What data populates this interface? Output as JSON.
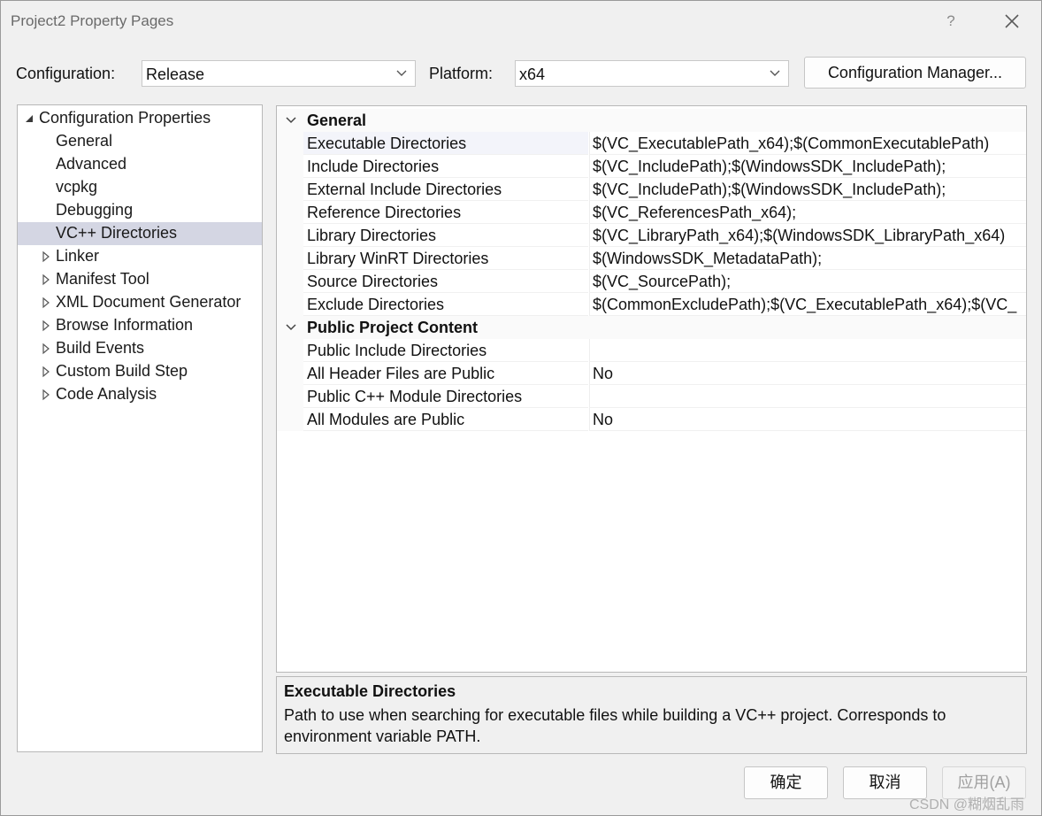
{
  "window": {
    "title": "Project2 Property Pages",
    "help_glyph": "?"
  },
  "config": {
    "configuration_label": "Configuration:",
    "configuration_value": "Release",
    "platform_label": "Platform:",
    "platform_value": "x64",
    "manager_button": "Configuration Manager..."
  },
  "tree": {
    "root": "Configuration Properties",
    "items": [
      {
        "label": "General",
        "expandable": false,
        "selected": false
      },
      {
        "label": "Advanced",
        "expandable": false,
        "selected": false
      },
      {
        "label": "vcpkg",
        "expandable": false,
        "selected": false
      },
      {
        "label": "Debugging",
        "expandable": false,
        "selected": false
      },
      {
        "label": "VC++ Directories",
        "expandable": false,
        "selected": true
      },
      {
        "label": "Linker",
        "expandable": true,
        "selected": false
      },
      {
        "label": "Manifest Tool",
        "expandable": true,
        "selected": false
      },
      {
        "label": "XML Document Generator",
        "expandable": true,
        "selected": false
      },
      {
        "label": "Browse Information",
        "expandable": true,
        "selected": false
      },
      {
        "label": "Build Events",
        "expandable": true,
        "selected": false
      },
      {
        "label": "Custom Build Step",
        "expandable": true,
        "selected": false
      },
      {
        "label": "Code Analysis",
        "expandable": true,
        "selected": false
      }
    ]
  },
  "grid": {
    "categories": [
      {
        "label": "General",
        "rows": [
          {
            "name": "Executable Directories",
            "value": "$(VC_ExecutablePath_x64);$(CommonExecutablePath)"
          },
          {
            "name": "Include Directories",
            "value": "$(VC_IncludePath);$(WindowsSDK_IncludePath);"
          },
          {
            "name": "External Include Directories",
            "value": "$(VC_IncludePath);$(WindowsSDK_IncludePath);"
          },
          {
            "name": "Reference Directories",
            "value": "$(VC_ReferencesPath_x64);"
          },
          {
            "name": "Library Directories",
            "value": "$(VC_LibraryPath_x64);$(WindowsSDK_LibraryPath_x64)"
          },
          {
            "name": "Library WinRT Directories",
            "value": "$(WindowsSDK_MetadataPath);"
          },
          {
            "name": "Source Directories",
            "value": "$(VC_SourcePath);"
          },
          {
            "name": "Exclude Directories",
            "value": "$(CommonExcludePath);$(VC_ExecutablePath_x64);$(VC_"
          }
        ]
      },
      {
        "label": "Public Project Content",
        "rows": [
          {
            "name": "Public Include Directories",
            "value": ""
          },
          {
            "name": "All Header Files are Public",
            "value": "No"
          },
          {
            "name": "Public C++ Module Directories",
            "value": ""
          },
          {
            "name": "All Modules are Public",
            "value": "No"
          }
        ]
      }
    ]
  },
  "description": {
    "heading": "Executable Directories",
    "body": "Path to use when searching for executable files while building a VC++ project.  Corresponds to environment variable PATH."
  },
  "buttons": {
    "ok": "确定",
    "cancel": "取消",
    "apply": "应用(A)"
  },
  "watermark": "CSDN @糊烟乱雨"
}
